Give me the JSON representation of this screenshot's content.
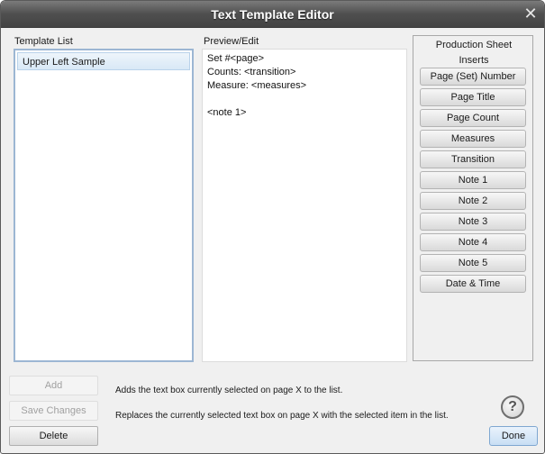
{
  "window": {
    "title": "Text Template Editor"
  },
  "template_list": {
    "label": "Template List",
    "items": [
      "Upper Left Sample"
    ],
    "selected": "Upper Left Sample"
  },
  "preview": {
    "label": "Preview/Edit",
    "text": "Set #<page>\nCounts: <transition>\nMeasure: <measures>\n\n<note 1>"
  },
  "inserts": {
    "title": "Production Sheet Inserts",
    "buttons": [
      "Page (Set) Number",
      "Page Title",
      "Page Count",
      "Measures",
      "Transition",
      "Note 1",
      "Note 2",
      "Note 3",
      "Note 4",
      "Note 5",
      "Date & Time"
    ]
  },
  "actions": {
    "add": "Add",
    "save_changes": "Save Changes",
    "delete": "Delete",
    "add_desc": "Adds the text box currently selected on page X to the list.",
    "save_desc": "Replaces the currently selected text box on page X with the selected item in the list."
  },
  "footer": {
    "done": "Done",
    "help_glyph": "?"
  },
  "colors": {
    "title_bar": "#4f4f4f",
    "selection": "#d8e8f6",
    "done_button": "#c8def4"
  }
}
